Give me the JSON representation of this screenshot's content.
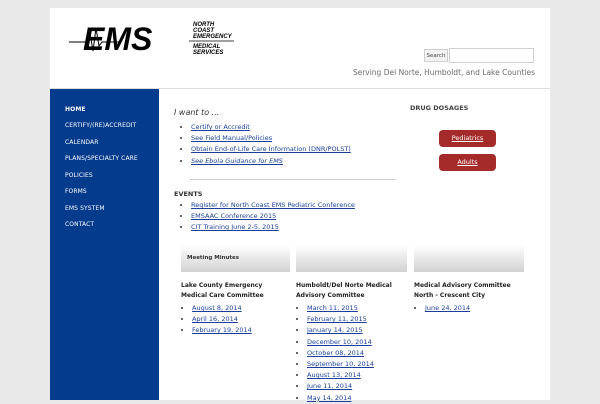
{
  "header": {
    "logo_text": "EMS",
    "logo_subtext": [
      "NORTH",
      "COAST",
      "EMERGENCY",
      "MEDICAL",
      "SERVICES"
    ],
    "search_button_label": "Search",
    "search_placeholder": "",
    "tagline": "Serving Del Norte, Humboldt, and Lake Counties"
  },
  "sidebar": {
    "items": [
      {
        "label": "HOME",
        "active": true
      },
      {
        "label": "CERTIFY/(RE)ACCREDIT"
      },
      {
        "label": "CALENDAR"
      },
      {
        "label": "PLANS/SPECIALTY CARE"
      },
      {
        "label": "POLICIES"
      },
      {
        "label": "FORMS"
      },
      {
        "label": "EMS SYSTEM"
      },
      {
        "label": "CONTACT"
      }
    ]
  },
  "main": {
    "want_title": "I want to ...",
    "want_links": [
      "Certify or Accredit",
      "See Field Manual/Policies",
      "Obtain End-of-Life Care Information (DNR/POLST)",
      "See Ebola Guidance for EMS"
    ],
    "events_title": "EVENTS",
    "events_links": [
      "Register for North Coast EMS Pediatric Conference",
      "EMSAAC Conference 2015",
      "CIT Training June 2-5, 2015"
    ]
  },
  "drug": {
    "title": "DRUG DOSAGES",
    "buttons": [
      "Pediatrics",
      "Adults"
    ]
  },
  "meeting": {
    "header": "Meeting Minutes",
    "columns": [
      {
        "title": "Lake County Emergency Medical Care Committee",
        "links": [
          "August 8, 2014",
          "April 16, 2014",
          "February 19, 2014"
        ]
      },
      {
        "title": "Humboldt/Del Norte Medical Advisory Committee",
        "links": [
          "March 11, 2015",
          "February 11, 2015",
          "January 14, 2015",
          "December 10, 2014",
          "October 08, 2014",
          "September 10, 2014",
          "August 13, 2014",
          "June 11, 2014",
          "May 14, 2014"
        ]
      },
      {
        "title": "Medical Advisory Committee North - Crescent City",
        "links": [
          "June 24, 2014"
        ]
      }
    ]
  },
  "colors": {
    "nav_bg": "#053b8c",
    "button_red": "#a52a2a",
    "link_blue": "#1a3f9b"
  }
}
